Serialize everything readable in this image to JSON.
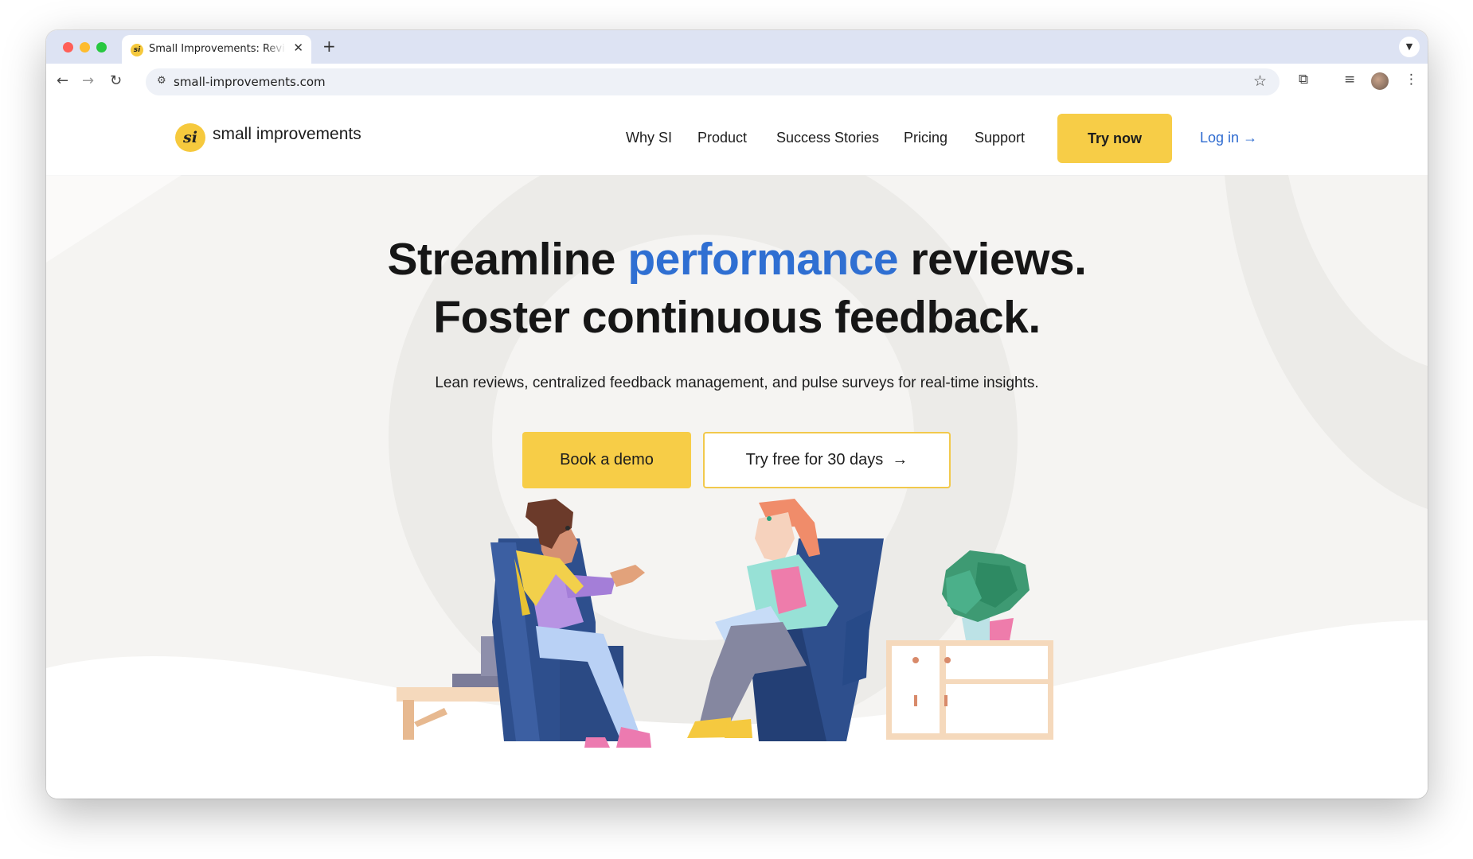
{
  "browser": {
    "tab": {
      "title": "Small Improvements: Reviews",
      "favicon": "si-logo-icon"
    },
    "url": "small-improvements.com",
    "icons": [
      "back-arrow-icon",
      "forward-arrow-icon",
      "reload-icon",
      "site-info-icon",
      "star-icon",
      "extensions-icon",
      "media-icon",
      "profile-avatar",
      "kebab-menu-icon"
    ]
  },
  "site": {
    "logo": {
      "mark": "si",
      "name": "small improvements"
    },
    "nav": [
      "Why SI",
      "Product",
      "Success Stories",
      "Pricing",
      "Support"
    ],
    "try_now": "Try now",
    "login": "Log in",
    "login_arrow": "→"
  },
  "hero": {
    "headline_part1": "Streamline ",
    "headline_accent": "performance",
    "headline_part2": " reviews.",
    "headline_line2": "Foster continuous feedback.",
    "subtitle": "Lean reviews, centralized feedback management, and pulse surveys for real-time insights.",
    "cta_primary": "Book a demo",
    "cta_secondary": "Try free for 30 days",
    "cta_secondary_arrow": "→"
  },
  "colors": {
    "brand_yellow": "#f7cd47",
    "accent_blue": "#2f6fd2",
    "text": "#161616",
    "bg": "#f5f4f2"
  }
}
